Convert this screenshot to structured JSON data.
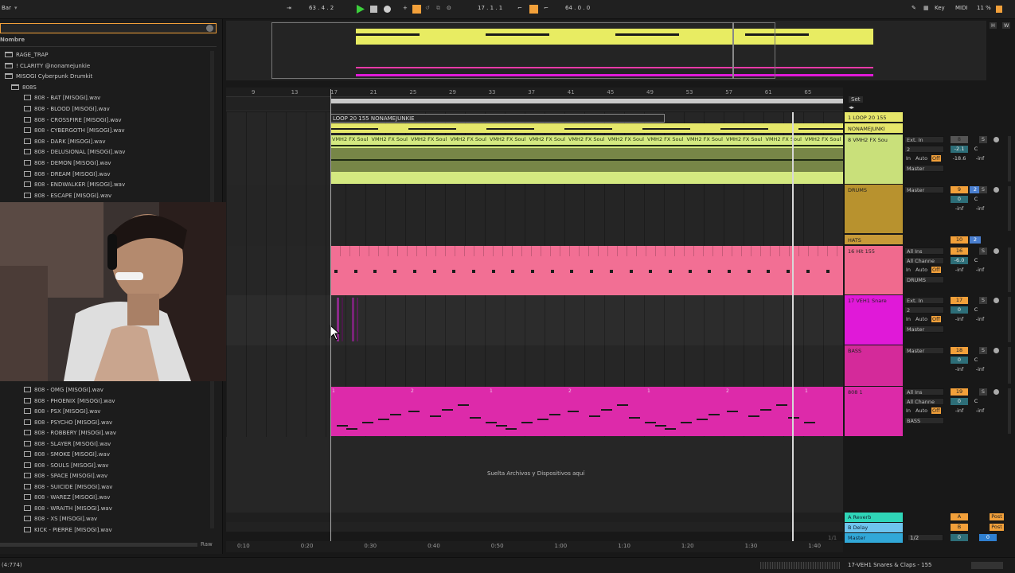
{
  "topbar": {
    "left_label": "Bar",
    "tempo_position": "63 . 4 . 2",
    "position": "17 . 1 . 1",
    "loop_length": "64 . 0 . 0",
    "key_label": "Key",
    "midi_label": "MIDI",
    "cpu": "11 %",
    "h_label": "H",
    "w_label": "W"
  },
  "browser": {
    "header": "Nombre",
    "items_top": [
      {
        "type": "folder",
        "label": "RAGE_TRAP"
      },
      {
        "type": "folder",
        "label": "! CLARITY @nonamejunkie"
      },
      {
        "type": "folder",
        "label": "MISOGI Cyberpunk Drumkit"
      },
      {
        "type": "folder",
        "label": "808S"
      },
      {
        "type": "file",
        "label": "808 - BAT [MISOGI].wav"
      },
      {
        "type": "file",
        "label": "808 - BLOOD [MISOGI].wav"
      },
      {
        "type": "file",
        "label": "808 - CROSSFIRE [MISOGI].wav"
      },
      {
        "type": "file",
        "label": "808 - CYBERGOTH [MISOGI].wav"
      },
      {
        "type": "file",
        "label": "808 - DARK [MISOGI].wav"
      },
      {
        "type": "file",
        "label": "808 - DELUSIONAL [MISOGI].wav"
      },
      {
        "type": "file",
        "label": "808 - DEMON [MISOGI].wav"
      },
      {
        "type": "file",
        "label": "808 - DREAM [MISOGI].wav"
      },
      {
        "type": "file",
        "label": "808 - ENDWALKER [MISOGI].wav"
      },
      {
        "type": "file",
        "label": "808 - ESCAPE [MISOGI].wav"
      }
    ],
    "items_bottom": [
      {
        "type": "file",
        "label": "808 - OMG [MISOGI].wav"
      },
      {
        "type": "file",
        "label": "808 - PHOENIX [MISOGI].wav"
      },
      {
        "type": "file",
        "label": "808 - PSX [MISOGI].wav"
      },
      {
        "type": "file",
        "label": "808 - PSYCHO [MISOGI].wav"
      },
      {
        "type": "file",
        "label": "808 - ROBBERY [MISOGI].wav"
      },
      {
        "type": "file",
        "label": "808 - SLAYER [MISOGI].wav"
      },
      {
        "type": "file",
        "label": "808 - SMOKE [MISOGI].wav"
      },
      {
        "type": "file",
        "label": "808 - SOULS [MISOGI].wav"
      },
      {
        "type": "file",
        "label": "808 - SPACE [MISOGI].wav"
      },
      {
        "type": "file",
        "label": "808 - SUICIDE [MISOGI].wav"
      },
      {
        "type": "file",
        "label": "808 - WAREZ [MISOGI].wav"
      },
      {
        "type": "file",
        "label": "808 - WRAITH [MISOGI].wav"
      },
      {
        "type": "file",
        "label": "808 - XS [MISOGI].wav"
      },
      {
        "type": "file",
        "label": "KICK - PIERRE [MISOGI].wav"
      }
    ],
    "raw_label": "Raw"
  },
  "ruler": {
    "bars": [
      "9",
      "13",
      "17",
      "21",
      "25",
      "29",
      "33",
      "37",
      "41",
      "45",
      "49",
      "53",
      "57",
      "61",
      "65"
    ],
    "set_label": "Set",
    "times": [
      "0:10",
      "0:20",
      "0:30",
      "0:40",
      "0:50",
      "1:00",
      "1:10",
      "1:20",
      "1:30",
      "1:40"
    ],
    "page": "1/1"
  },
  "arrangement": {
    "loop_clip": "LOOP 20 155 NONAMEJUNKIE",
    "fx_clip": "VMH2 FX Soul",
    "drop_hint": "Suelta Archivos y Dispositivos aquí"
  },
  "tracks": [
    {
      "name": "1 LOOP 20 155",
      "color": "#e6e66a"
    },
    {
      "name": "NONAMEJUNKI",
      "color": "#e6e66a"
    },
    {
      "name": "8 VMH2 FX Sou",
      "color": "#c9e07a",
      "input": "Ext. In",
      "channel": "2",
      "out": "Master",
      "vol": "-2.1",
      "pan": "C",
      "send": "-18.6",
      "send2": "-inf",
      "num": "8"
    },
    {
      "name": "DRUMS",
      "color": "#b8922e",
      "out": "Master",
      "num": "9",
      "num2": "2",
      "vol": "0",
      "pan": "C",
      "send": "-inf",
      "send2": "-inf"
    },
    {
      "name": "HATS",
      "color": "#c79a38",
      "num": "10",
      "num2": "2"
    },
    {
      "name": "16 Hit 155",
      "color": "#f06a8e",
      "input": "All Ins",
      "channel": "All Channe",
      "out": "DRUMS",
      "num": "16",
      "vol": "-6.0",
      "pan": "C",
      "send": "-inf",
      "send2": "-inf"
    },
    {
      "name": "17 VEH1 Snare",
      "color": "#e019d8",
      "input": "Ext. In",
      "channel": "2",
      "out": "Master",
      "num": "17",
      "vol": "0",
      "pan": "C",
      "send": "-inf",
      "send2": "-inf"
    },
    {
      "name": "BASS",
      "color": "#d42a9a",
      "out": "Master",
      "num": "18",
      "vol": "0",
      "pan": "C",
      "send": "-inf",
      "send2": "-inf"
    },
    {
      "name": "808 1",
      "color": "#dc2aa8",
      "input": "All Ins",
      "channel": "All Channe",
      "out": "BASS",
      "num": "19",
      "vol": "0",
      "pan": "C",
      "send": "-inf",
      "send2": "-inf"
    }
  ],
  "returns": [
    {
      "name": "A Reverb",
      "color": "#2fd6b8",
      "letter": "A",
      "post": "Post"
    },
    {
      "name": "B Delay",
      "color": "#6ec4ee",
      "letter": "B",
      "post": "Post"
    },
    {
      "name": "Master",
      "color": "#31a8d8",
      "value": "1/2",
      "vol": "0",
      "pan": "0"
    }
  ],
  "mixer": {
    "in_label": "In",
    "auto_label": "Auto",
    "off_label": "Off",
    "s_label": "S"
  },
  "status": {
    "left": "(4:774)",
    "right": "17-VEH1 Snares & Claps - 155"
  }
}
